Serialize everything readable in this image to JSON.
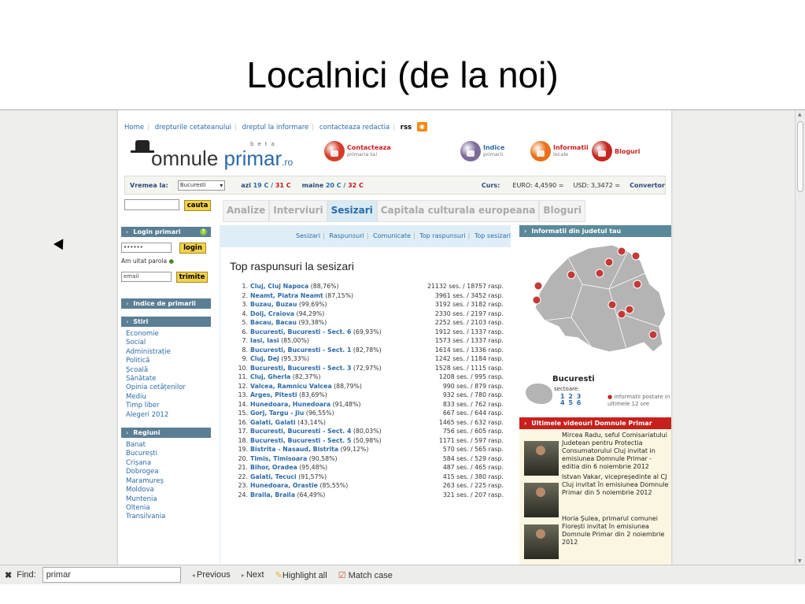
{
  "slide": {
    "title": "Localnici (de la noi)"
  },
  "site": {
    "topnav": {
      "links": [
        "Home",
        "drepturile cetateanului",
        "dreptul la informare",
        "contacteaza redactia"
      ],
      "rss_label": "rss"
    },
    "logo": {
      "text_a": "omnule ",
      "text_b": "primar",
      "tld": ".ro",
      "beta": "beta"
    },
    "header_buttons": [
      {
        "label": "Contacteaza",
        "sub": "primaria ta!",
        "color": "#d43d2a"
      },
      {
        "label": "Indice",
        "sub": "primarii",
        "color": "#7d6a9a"
      },
      {
        "label": "Informatii",
        "sub": "locale",
        "color": "#e8701a"
      },
      {
        "label": "Bloguri",
        "sub": "",
        "color": "#c3261d"
      }
    ],
    "weather": {
      "label": "Vremea la:",
      "city": "Bucuresti",
      "today": "azi",
      "today_min": "19 C",
      "today_max": "31 C",
      "tomorrow": "maine",
      "tomorrow_min": "20 C",
      "tomorrow_max": "32 C",
      "rates_label": "Curs:",
      "euro": "EURO: 4,4590 =",
      "usd": "USD: 3,3472 =",
      "converter": "Convertor"
    },
    "search": {
      "button": "cauta"
    },
    "tabs": [
      "Analize",
      "Interviuri",
      "Sesizari",
      "Capitala culturala europeana",
      "Bloguri"
    ],
    "subnav": [
      "Sesizari",
      "Raspunsuri",
      "Comunicate",
      "Top raspunsuri",
      "Top sesizari"
    ]
  },
  "sidebar": {
    "login": {
      "title": "Login primari",
      "password": "••••••",
      "login_button": "login",
      "forgot": "Am uitat parola",
      "email_placeholder": "email",
      "send_button": "trimite"
    },
    "indice": "Indice de primarii",
    "stiri_title": "Stiri",
    "stiri": [
      "Economie",
      "Social",
      "Administrație",
      "Politică",
      "Școală",
      "Sănătate",
      "Opinia cetățenilor",
      "Mediu",
      "Timp liber",
      "Alegeri 2012"
    ],
    "regiuni_title": "Regiuni",
    "regiuni": [
      "Banat",
      "București",
      "Crișana",
      "Dobrogea",
      "Maramureș",
      "Moldova",
      "Muntenia",
      "Oltenia",
      "Transilvania"
    ]
  },
  "main": {
    "list_title": "Top raspunsuri la sesizari",
    "rows": [
      {
        "n": "1.",
        "place": "Cluj, Cluj Napoca",
        "pct": " (88,76%)",
        "stat": "21132 ses. / 18757 rasp."
      },
      {
        "n": "2.",
        "place": "Neamt, Piatra Neamt",
        "pct": " (87,15%)",
        "stat": "3961 ses. / 3452 rasp."
      },
      {
        "n": "3.",
        "place": "Buzau, Buzau",
        "pct": " (99,69%)",
        "stat": "3192 ses. / 3182 rasp."
      },
      {
        "n": "4.",
        "place": "Dolj, Craiova",
        "pct": " (94,29%)",
        "stat": "2330 ses. / 2197 rasp."
      },
      {
        "n": "5.",
        "place": "Bacau, Bacau",
        "pct": " (93,38%)",
        "stat": "2252 ses. / 2103 rasp."
      },
      {
        "n": "6.",
        "place": "Bucuresti, Bucuresti - Sect. 6",
        "pct": " (69,93%)",
        "stat": "1912 ses. / 1337 rasp."
      },
      {
        "n": "7.",
        "place": "Iasi, Iasi",
        "pct": " (85,00%)",
        "stat": "1573 ses. / 1337 rasp."
      },
      {
        "n": "8.",
        "place": "Bucuresti, Bucuresti - Sect. 1",
        "pct": " (82,78%)",
        "stat": "1614 ses. / 1336 rasp."
      },
      {
        "n": "9.",
        "place": "Cluj, Dej",
        "pct": " (95,33%)",
        "stat": "1242 ses. / 1184 rasp."
      },
      {
        "n": "10.",
        "place": "Bucuresti, Bucuresti - Sect. 3",
        "pct": " (72,97%)",
        "stat": "1528 ses. / 1115 rasp."
      },
      {
        "n": "11.",
        "place": "Cluj, Gherla",
        "pct": " (82,37%)",
        "stat": "1208 ses. / 995 rasp."
      },
      {
        "n": "12.",
        "place": "Valcea, Ramnicu Valcea",
        "pct": " (88,79%)",
        "stat": "990 ses. / 879 rasp."
      },
      {
        "n": "13.",
        "place": "Arges, Pitesti",
        "pct": " (83,69%)",
        "stat": "932 ses. / 780 rasp."
      },
      {
        "n": "14.",
        "place": "Hunedoara, Hunedoara",
        "pct": " (91,48%)",
        "stat": "833 ses. / 762 rasp."
      },
      {
        "n": "15.",
        "place": "Gorj, Targu - Jiu",
        "pct": " (96,55%)",
        "stat": "667 ses. / 644 rasp."
      },
      {
        "n": "16.",
        "place": "Galati, Galati",
        "pct": " (43,14%)",
        "stat": "1465 ses. / 632 rasp."
      },
      {
        "n": "17.",
        "place": "Bucuresti, Bucuresti - Sect. 4",
        "pct": " (80,03%)",
        "stat": "756 ses. / 605 rasp."
      },
      {
        "n": "18.",
        "place": "Bucuresti, Bucuresti - Sect. 5",
        "pct": " (50,98%)",
        "stat": "1171 ses. / 597 rasp."
      },
      {
        "n": "19.",
        "place": "Bistrita - Nasaud, Bistrita",
        "pct": " (99,12%)",
        "stat": "570 ses. / 565 rasp."
      },
      {
        "n": "20.",
        "place": "Timis, Timisoara",
        "pct": " (90,58%)",
        "stat": "584 ses. / 529 rasp."
      },
      {
        "n": "21.",
        "place": "Bihor, Oradea",
        "pct": " (95,48%)",
        "stat": "487 ses. / 465 rasp."
      },
      {
        "n": "22.",
        "place": "Galati, Tecuci",
        "pct": " (91,57%)",
        "stat": "415 ses. / 380 rasp."
      },
      {
        "n": "23.",
        "place": "Hunedoara, Orastie",
        "pct": " (85,55%)",
        "stat": "263 ses. / 225 rasp."
      },
      {
        "n": "24.",
        "place": "Braila, Braila",
        "pct": " (64,49%)",
        "stat": "321 ses. / 207 rasp."
      }
    ]
  },
  "right": {
    "map_title": "Informatii din judetul tau",
    "city": "Bucuresti",
    "sectors_label": "sectoare:",
    "sectors_row1": "1 2 3",
    "sectors_row2": "4 5 6",
    "note": "informatii postate in ultimele 12 ore",
    "video_title_a": "Ultimele videouri ",
    "video_title_b": "Domnule Primar",
    "videos": [
      "Mircea Radu, seful Comisariatului Judetean pentru Protectia Consumatorului Cluj invitat in emisiunea Domnule Primar - editia din 6 noiembrie 2012",
      "Istvan Vakar, vicepreședinte al CJ Cluj invitat în emisiunea Domnule Primar din 5 noiembrie 2012",
      "Horia Șulea, primarul comunei Florești invitat în emisiunea Domnule Primar din 2 noiembrie 2012"
    ],
    "map_header_color": "#5a8a9a",
    "video_header_color": "#c8201d"
  },
  "findbar": {
    "label": "Find:",
    "value": "primar",
    "previous": "Previous",
    "next": "Next",
    "highlight": "Highlight all",
    "match_case": "Match case"
  }
}
